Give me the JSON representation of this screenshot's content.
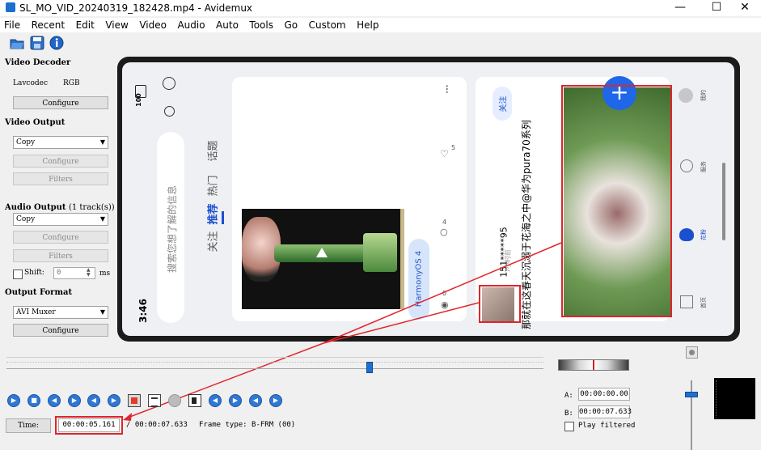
{
  "window": {
    "title": "SL_MO_VID_20240319_182428.mp4 - Avidemux",
    "min": "—",
    "max": "☐",
    "close": "✕"
  },
  "menu": [
    "File",
    "Recent",
    "Edit",
    "View",
    "Video",
    "Audio",
    "Auto",
    "Tools",
    "Go",
    "Custom",
    "Help"
  ],
  "video_decoder": {
    "heading": "Video Decoder",
    "codec": "Lavcodec",
    "format": "RGB",
    "configure": "Configure"
  },
  "video_output": {
    "heading": "Video Output",
    "value": "Copy",
    "configure": "Configure",
    "filters": "Filters"
  },
  "audio_output": {
    "heading": "Audio Output",
    "tracks": "(1 track(s))",
    "value": "Copy",
    "configure": "Configure",
    "filters": "Filters",
    "shift_label": "Shift:",
    "shift_value": "0",
    "unit": "ms"
  },
  "output_format": {
    "heading": "Output Format",
    "value": "AVI Muxer",
    "configure": "Configure"
  },
  "phone": {
    "time": "3:46",
    "battery": "100",
    "search_placeholder": "搜索您想了解的信息",
    "tabs": [
      "关注",
      "推荐",
      "热门",
      "话题"
    ],
    "like_count": "5",
    "comment_count": "4",
    "view_count": "0",
    "harmony_tag": "HarmonyOS 4",
    "follow": "关注",
    "username": "151*****95",
    "user_sub": "7小时前",
    "post_text": "那就在这春天沉溺于花海之中@华为pura70系列",
    "nav": [
      "我的",
      "服务",
      "花粉",
      "首页"
    ],
    "dots": "..."
  },
  "time": {
    "label": "Time:",
    "current": "00:00:05.161",
    "total": "/ 00:00:07.633",
    "frame_type": "Frame type: B-FRM (00)"
  },
  "ab": {
    "a_label": "A:",
    "a_value": "00:00:00.00",
    "b_label": "B:",
    "b_value": "00:00:07.633",
    "play_filtered": "Play filtered"
  },
  "playback_fraction": 0.676,
  "volume_fraction": 0.93,
  "annotation_color": "#e0252b"
}
